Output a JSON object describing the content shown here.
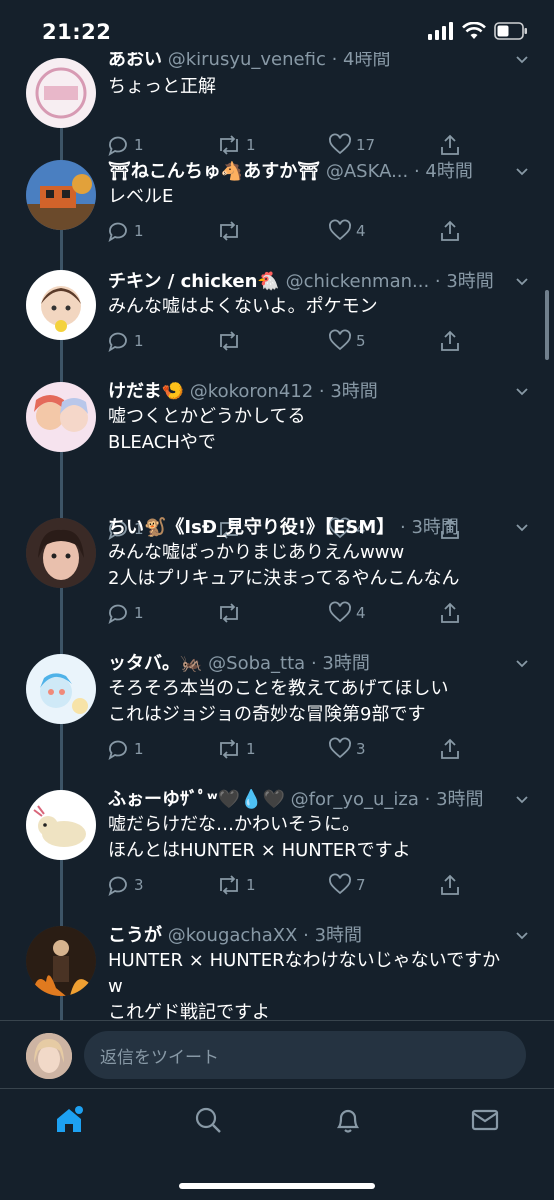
{
  "status_bar": {
    "time": "21:22"
  },
  "tweets": [
    {
      "name": "あおい",
      "handle": "@kirusyu_venefic",
      "time": "· 4時間",
      "lines": [
        "ちょっと正解"
      ],
      "reply_count": "1",
      "retweet_count": "1",
      "like_count": "17"
    },
    {
      "name": "⛩ねこんちゅ🐴あすか⛩",
      "handle": "@ASKA...",
      "time": "· 4時間",
      "lines": [
        "レベルE"
      ],
      "reply_count": "1",
      "retweet_count": "",
      "like_count": "4"
    },
    {
      "name": "チキン / chicken🐔",
      "handle": "@chickenman...",
      "time": "· 3時間",
      "lines": [
        "みんな嘘はよくないよ。ポケモン"
      ],
      "reply_count": "1",
      "retweet_count": "",
      "like_count": "5"
    },
    {
      "name": "けだま🍤",
      "handle": "@kokoron412",
      "time": "· 3時間",
      "lines": [
        "嘘つくとかどうかしてる",
        "BLEACHやで"
      ],
      "reply_count": "1",
      "retweet_count": "",
      "like_count": "4"
    },
    {
      "name": "ちい🐒《IsÐ_見守り役!》【ESM】",
      "handle": "",
      "time": "· 3時間",
      "lines": [
        "みんな嘘ばっかりまじありえんwww",
        "2人はプリキュアに決まってるやんこんなん"
      ],
      "reply_count": "1",
      "retweet_count": "",
      "like_count": "4"
    },
    {
      "name": "ッタバ。🦗",
      "handle": "@Soba_tta",
      "time": "· 3時間",
      "lines": [
        "そろそろ本当のことを教えてあげてほしい",
        "これはジョジョの奇妙な冒険第9部です"
      ],
      "reply_count": "1",
      "retweet_count": "1",
      "like_count": "3"
    },
    {
      "name": "ふぉーゆｻﾞﾟʷ🖤💧🖤",
      "handle": "@for_yo_u_iza",
      "time": "· 3時間",
      "lines": [
        "嘘だらけだな…かわいそうに。",
        "ほんとはHUNTER × HUNTERですよ"
      ],
      "reply_count": "3",
      "retweet_count": "1",
      "like_count": "7"
    },
    {
      "name": "こうが",
      "handle": "@kougachaXX",
      "time": "· 3時間",
      "lines": [
        "HUNTER × HUNTERなわけないじゃないですか",
        "w",
        "これゲド戦記ですよ"
      ],
      "reply_count": "",
      "retweet_count": "",
      "like_count": ""
    }
  ],
  "composer": {
    "placeholder": "返信をツイート"
  },
  "tab_bar": {
    "items": [
      "home-icon",
      "search-icon",
      "notifications-icon",
      "messages-icon"
    ]
  },
  "colors": {
    "background": "#15202b",
    "accent": "#1da1f2",
    "secondary_text": "#8899a6",
    "divider": "#38444d"
  }
}
